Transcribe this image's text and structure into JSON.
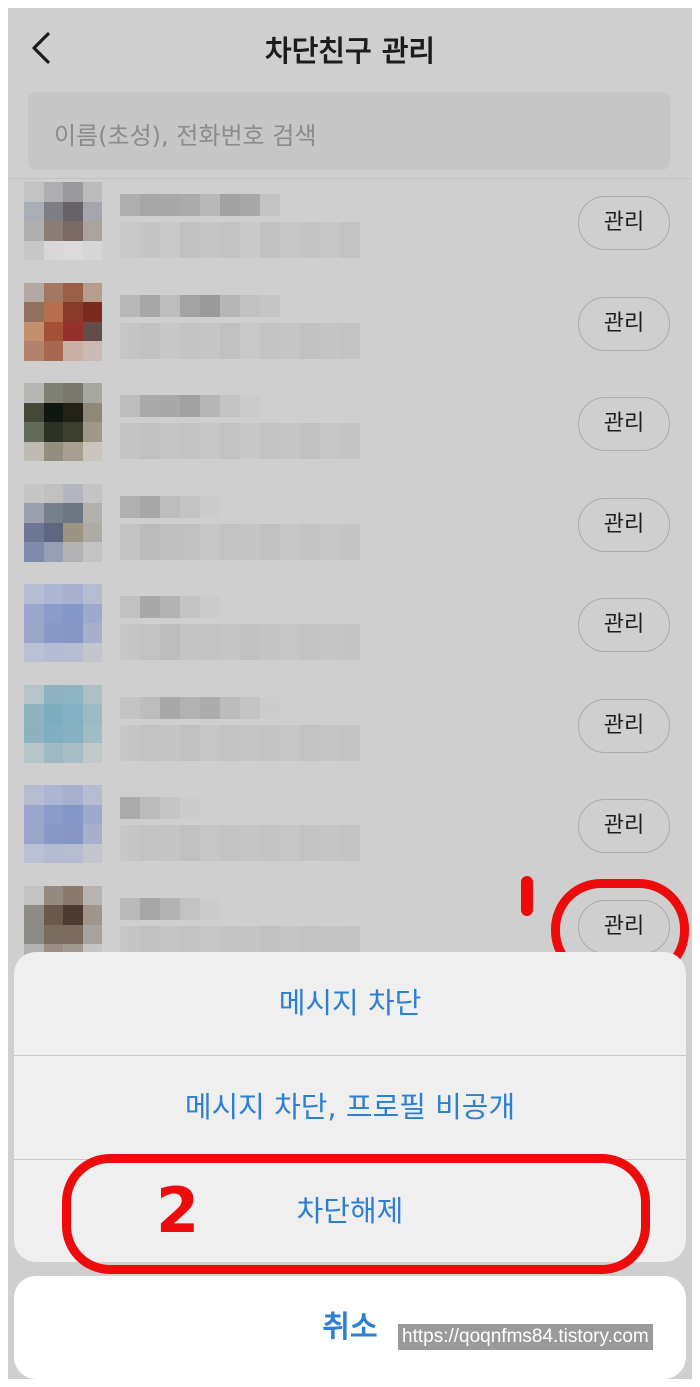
{
  "header": {
    "title": "차단친구 관리"
  },
  "search": {
    "placeholder": "이름(초성), 전화번호 검색"
  },
  "rows": [
    {
      "manage_label": "관리",
      "avatar": [
        "#c2c2c2",
        "#aeaeb1",
        "#9a9a9d",
        "#bcbcbc",
        "#a9adb6",
        "#7d7f84",
        "#666266",
        "#a4a5ad",
        "#b2b0ae",
        "#8b7c74",
        "#7a6a63",
        "#aaa29c",
        "#c8c8c8",
        "#d7d7d7",
        "#dadada",
        "#d6d6d6"
      ],
      "name": [
        "#aeaeae",
        "#a7a7a7",
        "#a9a9a9",
        "#ababab",
        "#b8b8b8",
        "#a2a2a2",
        "#a8a8a8",
        "#c3c3c3",
        "#cfcfcf"
      ],
      "sub": [
        "#c9c9c9",
        "#c4c4c4",
        "#c9c9c9",
        "#c0c0c0",
        "#c6c6c6",
        "#c2c2c2",
        "#cacaca",
        "#c0c0c0",
        "#c7c7c7",
        "#c3c3c3",
        "#c7c7c7",
        "#c1c1c1"
      ]
    },
    {
      "manage_label": "관리",
      "avatar": [
        "#b4a9a2",
        "#a27764",
        "#9b5e47",
        "#b89d8e",
        "#92725e",
        "#b66e4f",
        "#8b3a2a",
        "#7b2a1c",
        "#c0906f",
        "#a45037",
        "#95302d",
        "#624d4a",
        "#b1826c",
        "#a86850",
        "#c8b1a4",
        "#c9bab3"
      ],
      "name": [
        "#b8b8b8",
        "#a7a7a7",
        "#bdbdbd",
        "#a3a3a3",
        "#9a9a9a",
        "#b6b6b6",
        "#c1c1c1",
        "#c6c6c6"
      ],
      "sub": [
        "#c5c5c5",
        "#c0c0c0",
        "#c8c8c8",
        "#c3c3c3",
        "#c6c6c6",
        "#bfbfbf",
        "#c9c9c9",
        "#c3c3c3",
        "#c6c6c6",
        "#c0c0c0",
        "#c5c5c5",
        "#c2c2c2"
      ]
    },
    {
      "manage_label": "관리",
      "avatar": [
        "#b7b7b4",
        "#7e8174",
        "#79786d",
        "#a6a8a0",
        "#454838",
        "#101610",
        "#222218",
        "#8d8877",
        "#626b57",
        "#2e3226",
        "#3b3d2d",
        "#9f9887",
        "#bdbab2",
        "#948f7c",
        "#a7a08f",
        "#cac6bd"
      ],
      "name": [
        "#bdbdbd",
        "#aaaaaa",
        "#a9a9a9",
        "#a2a2a2",
        "#b6b6b6",
        "#c4c4c4",
        "#cbcbcb"
      ],
      "sub": [
        "#c3c3c3",
        "#bfbfbf",
        "#c6c6c6",
        "#c2c2c2",
        "#c7c7c7",
        "#c1c1c1",
        "#c8c8c8",
        "#c2c2c2",
        "#c6c6c6",
        "#c0c0c0",
        "#c7c7c7",
        "#c3c3c3"
      ]
    },
    {
      "manage_label": "관리",
      "avatar": [
        "#c6c6c6",
        "#c0c0c0",
        "#b3b6bf",
        "#c4c4c4",
        "#9aa1ad",
        "#777f8b",
        "#6d7583",
        "#b3b1ad",
        "#6c7893",
        "#5e6780",
        "#9d9382",
        "#aeaaa5",
        "#7e8cab",
        "#93a0b5",
        "#b2b2b3",
        "#c3c3c3"
      ],
      "name": [
        "#b1b1b1",
        "#a8a8a8",
        "#bdbdbd",
        "#c4c4c4",
        "#cccccc"
      ],
      "sub": [
        "#c2c2c2",
        "#b9b9b9",
        "#bebebe",
        "#bfbfbf",
        "#c7c7c7",
        "#c1c1c1",
        "#c5c5c5",
        "#bfbfbf",
        "#c7c7c7",
        "#c3c3c3",
        "#c7c7c7",
        "#c4c4c4"
      ]
    },
    {
      "manage_label": "관리",
      "avatar": [
        "#b6bdd2",
        "#aab6d4",
        "#a6b1d0",
        "#b7bdd1",
        "#9aa6cc",
        "#8b9ccc",
        "#8597c8",
        "#9daacc",
        "#9aa6c9",
        "#8797c6",
        "#8595c4",
        "#a6afcc",
        "#bbc1d4",
        "#b4bcd3",
        "#b6bcd1",
        "#c4c6cd"
      ],
      "name": [
        "#c1c1c1",
        "#a9a9a9",
        "#b3b3b3",
        "#c4c4c4",
        "#cbcbcb"
      ],
      "sub": [
        "#c6c6c6",
        "#c1c1c1",
        "#bdbdbd",
        "#c4c4c4",
        "#c3c3c3",
        "#c6c6c6",
        "#c0c0c0",
        "#c4c4c4",
        "#c7c7c7",
        "#c2c2c2",
        "#c6c6c6",
        "#c4c4c4"
      ]
    },
    {
      "manage_label": "관리",
      "avatar": [
        "#b4c4c9",
        "#8fb3c0",
        "#90b5c2",
        "#aebfc6",
        "#91b3c1",
        "#7aaebf",
        "#82b1c1",
        "#9bbac4",
        "#8fb2c0",
        "#7eaebf",
        "#84b0bf",
        "#a2bcc4",
        "#b6c5ca",
        "#9db9c3",
        "#a7bec6",
        "#c3c9cb"
      ],
      "name": [
        "#c3c3c3",
        "#bdbdbd",
        "#a9a9a9",
        "#b2b2b2",
        "#acacac",
        "#bcbcbc",
        "#c4c4c4",
        "#cccccc"
      ],
      "sub": [
        "#c6c6c6",
        "#c1c1c1",
        "#c5c5c5",
        "#bfbfbf",
        "#c7c7c7",
        "#c2c2c2",
        "#c6c6c6",
        "#c3c3c3",
        "#c7c7c7",
        "#c1c1c1",
        "#c6c6c6",
        "#c3c3c3"
      ]
    },
    {
      "manage_label": "관리",
      "avatar": [
        "#b6bdd2",
        "#aab6d4",
        "#a6b1d0",
        "#b7bdd1",
        "#9aa6cc",
        "#8b9ccc",
        "#8597c8",
        "#9daacc",
        "#9aa6c9",
        "#8797c6",
        "#8595c4",
        "#a6afcc",
        "#bbc1d4",
        "#b4bcd3",
        "#b6bcd1",
        "#c4c6cd"
      ],
      "name": [
        "#ababab",
        "#bcbcbc",
        "#c6c6c6",
        "#cccccc"
      ],
      "sub": [
        "#c6c6c6",
        "#c1c1c1",
        "#c5c5c5",
        "#bfbfbf",
        "#c7c7c7",
        "#c2c2c2",
        "#c6c6c6",
        "#c3c3c3",
        "#c7c7c7",
        "#c1c1c1",
        "#c6c6c6",
        "#c3c3c3"
      ]
    },
    {
      "manage_label": "관리",
      "avatar": [
        "#c2c2c2",
        "#958a80",
        "#8a7a6d",
        "#b6b3b0",
        "#8f8b87",
        "#6a5a4d",
        "#4e3a2e",
        "#9f958b",
        "#8c8b88",
        "#7b6c60",
        "#7a6b5e",
        "#a7a29d",
        "#b4b2b0",
        "#9a8d82",
        "#a19a93",
        "#c5c5c5"
      ],
      "name": [
        "#b9b9b9",
        "#a6a6a6",
        "#b3b3b3",
        "#c2c2c2",
        "#cccccc"
      ],
      "sub": [
        "#c5c5c5",
        "#bfbfbf",
        "#c6c6c6",
        "#c1c1c1",
        "#c7c7c7",
        "#c3c3c3",
        "#c5c5c5",
        "#bfbfbf",
        "#c6c6c6",
        "#c2c2c2",
        "#c5c5c5",
        "#c3c3c3"
      ]
    }
  ],
  "sheet": {
    "option_1": "메시지 차단",
    "option_2": "메시지 차단, 프로필 비공개",
    "option_3": "차단해제",
    "cancel": "취소"
  },
  "annotations": {
    "mark_1": "1",
    "mark_2": "2",
    "annotation_color": "#ee0b0b"
  },
  "watermark": "https://qoqnfms84.tistory.com",
  "colors": {
    "accent": "#2d7fd3",
    "overlay_bg": "#cfcfcf"
  }
}
